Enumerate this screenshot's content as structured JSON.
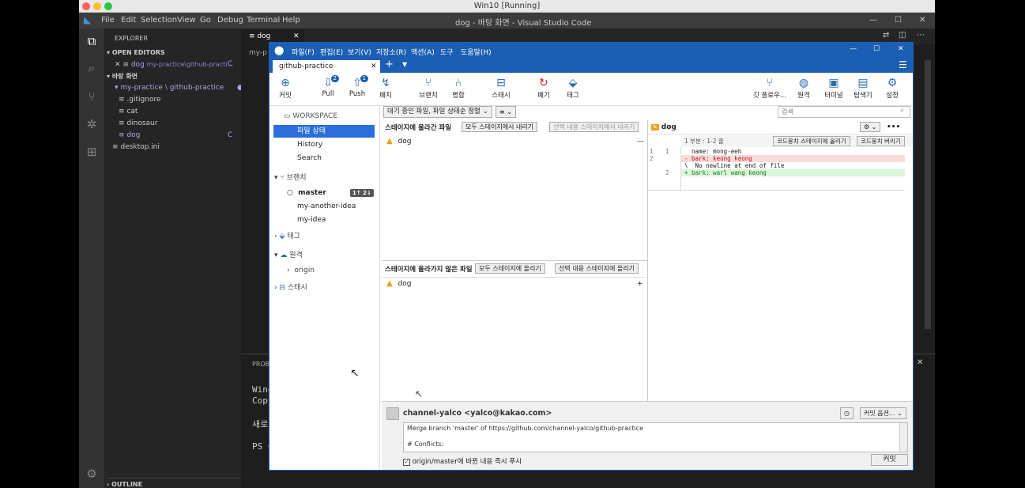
{
  "vm": {
    "title": "Win10 [Running]"
  },
  "vscode": {
    "window_title": "dog - 바탕 화면 - Visual Studio Code",
    "menu": [
      "File",
      "Edit",
      "Selection",
      "View",
      "Go",
      "Debug",
      "Terminal",
      "Help"
    ],
    "explorer_label": "EXPLORER",
    "open_editors_label": "OPEN EDITORS",
    "open_editor_file": "dog",
    "open_editor_path": "my-practice\\github-practi...",
    "open_editor_flag": "C",
    "folder_label": "바탕 화면",
    "repo_folder": "my-practice \\ github-practice",
    "files": [
      ".gitignore",
      "cat",
      "dinosaur",
      "dog"
    ],
    "dog_flag": "C",
    "desktop_file": "desktop.ini",
    "outline_label": "OUTLINE",
    "tab_name": "dog",
    "breadcrumb_fragment": "my-p",
    "panel_label": "PROBI",
    "terminal_lines": [
      "Wind",
      "Copy",
      "새로",
      "PS C"
    ]
  },
  "sourcetree": {
    "tab_name": "github-practice",
    "menu": [
      "파일(F)",
      "편집(E)",
      "보기(V)",
      "저장소(R)",
      "액션(A)",
      "도구",
      "도움말(H)"
    ],
    "toolbar": {
      "commit": "커밋",
      "pull": "Pull",
      "pull_badge": "2",
      "push": "Push",
      "push_badge": "1",
      "fetch": "패치",
      "branch": "브랜치",
      "merge": "병합",
      "stash": "스태시",
      "discard": "폐기",
      "tag": "태그",
      "git_flow": "깃 플로우...",
      "remote": "원격",
      "terminal": "터미널",
      "explorer": "탐색기",
      "settings": "설정"
    },
    "sidebar": {
      "workspace": "WORKSPACE",
      "file_status": "파일 상태",
      "history": "History",
      "search": "Search",
      "branches": "브랜치",
      "branch_list": [
        "master",
        "my-another-idea",
        "my-idea"
      ],
      "master_badge": "1↑ 2↓",
      "tags": "태그",
      "remotes": "원격",
      "remote_list": [
        "origin"
      ],
      "stashes": "스태시"
    },
    "filter": {
      "selected": "대기 중인 파일, 파일 상태순 정렬",
      "view_icon": "≡"
    },
    "search_placeholder": "검색",
    "staged": {
      "label": "스테이지에 올라간 파일",
      "unstage_all": "모두 스테이지에서 내리기",
      "unstage_selected": "선택 내용 스테이지에서 내리기",
      "files": [
        "dog"
      ]
    },
    "unstaged": {
      "label": "스테이지에 올라가지 않은 파일",
      "stage_all": "모두 스테이지에 올리기",
      "stage_selected": "선택 내용 스테이지에 올리기",
      "files": [
        "dog"
      ]
    },
    "diff": {
      "file": "dog",
      "hunk_label": "1 부분 : 1-2 줄",
      "stage_hunk": "코드뭉치 스테이지에 올리기",
      "discard_hunk": "코드뭉치 버리기",
      "lines": [
        {
          "old": "1",
          "new": "1",
          "text": "  name: mong-eeh",
          "kind": "ctx"
        },
        {
          "old": "2",
          "new": "",
          "text": "- bark: keong keong",
          "kind": "del"
        },
        {
          "old": "",
          "new": "",
          "text": "\\  No newline at end of file",
          "kind": "ctx"
        },
        {
          "old": "",
          "new": "2",
          "text": "+ bark: warl wang keong",
          "kind": "add"
        }
      ]
    },
    "commit": {
      "author": "channel-yalco <yalco@kakao.com>",
      "options": "커밋 옵션...",
      "message_lines": [
        "Merge branch 'master' of https://github.com/channel-yalco/github-practice",
        "",
        "# Conflicts:"
      ],
      "push_checkbox": "origin/master에 바뀐 내용 즉시 푸시",
      "commit_button": "커밋"
    }
  },
  "colors": {
    "accent": "#1a5fb4",
    "add": "#d9f7d9",
    "del": "#fbdcdc",
    "warn": "#e6a100"
  }
}
